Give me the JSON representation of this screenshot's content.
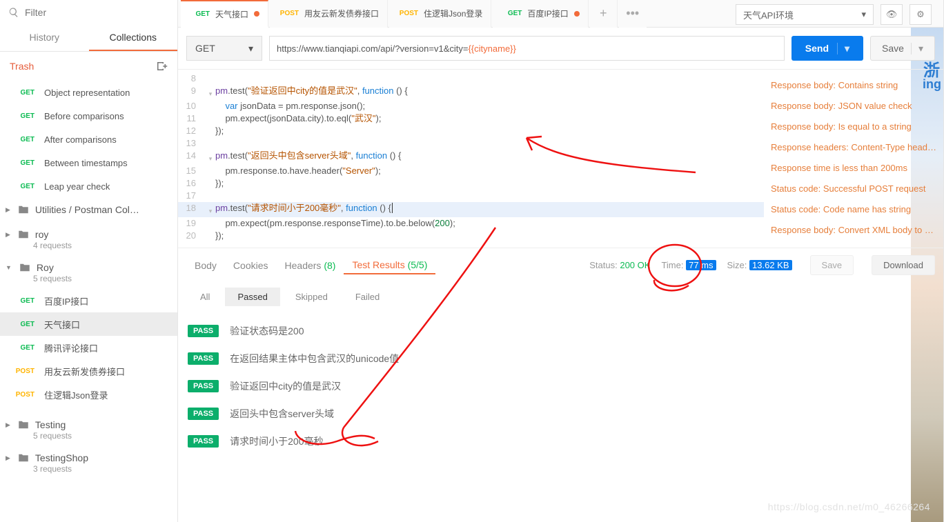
{
  "filter": {
    "placeholder": "Filter"
  },
  "sidebarTabs": {
    "history": "History",
    "collections": "Collections"
  },
  "trash": {
    "label": "Trash"
  },
  "snippetItems": [
    {
      "method": "GET",
      "label": "Object representation"
    },
    {
      "method": "GET",
      "label": "Before comparisons"
    },
    {
      "method": "GET",
      "label": "After comparisons"
    },
    {
      "method": "GET",
      "label": "Between timestamps"
    },
    {
      "method": "GET",
      "label": "Leap year check"
    }
  ],
  "utilFolder": "Utilities / Postman Col…",
  "folders": [
    {
      "name": "roy",
      "meta": "4 requests",
      "open": false
    },
    {
      "name": "Roy",
      "meta": "5 requests",
      "open": true,
      "items": [
        {
          "method": "GET",
          "label": "百度IP接口"
        },
        {
          "method": "GET",
          "label": "天气接口",
          "active": true
        },
        {
          "method": "GET",
          "label": "腾讯评论接口"
        },
        {
          "method": "POST",
          "label": "用友云新发债券接口"
        },
        {
          "method": "POST",
          "label": "住逻辑Json登录"
        }
      ]
    },
    {
      "name": "Testing",
      "meta": "5 requests",
      "open": false
    },
    {
      "name": "TestingShop",
      "meta": "3 requests",
      "open": false
    }
  ],
  "tabs": [
    {
      "method": "GET",
      "label": "天气接口",
      "dirty": true,
      "active": true
    },
    {
      "method": "POST",
      "label": "用友云新发债券接口"
    },
    {
      "method": "POST",
      "label": "住逻辑Json登录"
    },
    {
      "method": "GET",
      "label": "百度IP接口",
      "dirty": true
    }
  ],
  "env": {
    "label": "天气API环境"
  },
  "request": {
    "method": "GET",
    "urlBase": "https://www.tianqiapi.com/api/?version=v1&city=",
    "urlVar": "{{cityname}}",
    "send": "Send",
    "save": "Save"
  },
  "code": {
    "l8": "",
    "l9": "pm.test(\"验证返回中city的值是武汉\", function () {",
    "l10": "    var jsonData = pm.response.json();",
    "l11": "    pm.expect(jsonData.city).to.eql(\"武汉\");",
    "l12": "});",
    "l13": "",
    "l14": "pm.test(\"返回头中包含server头域\", function () {",
    "l15": "    pm.response.to.have.header(\"Server\");",
    "l16": "});",
    "l17": "",
    "l18": "pm.test(\"请求时间小于200毫秒\", function () {",
    "l19": "    pm.expect(pm.response.responseTime).to.be.below(200);",
    "l20": "});"
  },
  "snippets": [
    "Response body: Contains string",
    "Response body: JSON value check",
    "Response body: Is equal to a string",
    "Response headers: Content-Type header check",
    "Response time is less than 200ms",
    "Status code: Successful POST request",
    "Status code: Code name has string",
    "Response body: Convert XML body to a JSON"
  ],
  "respTabs": {
    "body": "Body",
    "cookies": "Cookies",
    "headers": "Headers",
    "headersCount": "(8)",
    "testResults": "Test Results",
    "trCount": "(5/5)"
  },
  "respMeta": {
    "statusL": "Status:",
    "status": "200 OK",
    "timeL": "Time:",
    "time": "77 ms",
    "sizeL": "Size:",
    "size": "13.62 KB",
    "save": "Save",
    "download": "Download"
  },
  "filterTabs": {
    "all": "All",
    "passed": "Passed",
    "skipped": "Skipped",
    "failed": "Failed"
  },
  "results": [
    "验证状态码是200",
    "在返回结果主体中包含武汉的unicode值",
    "验证返回中city的值是武汉",
    "返回头中包含server头域",
    "请求时间小于200毫秒"
  ],
  "passLabel": "PASS",
  "watermark": "https://blog.csdn.net/m0_46266264"
}
